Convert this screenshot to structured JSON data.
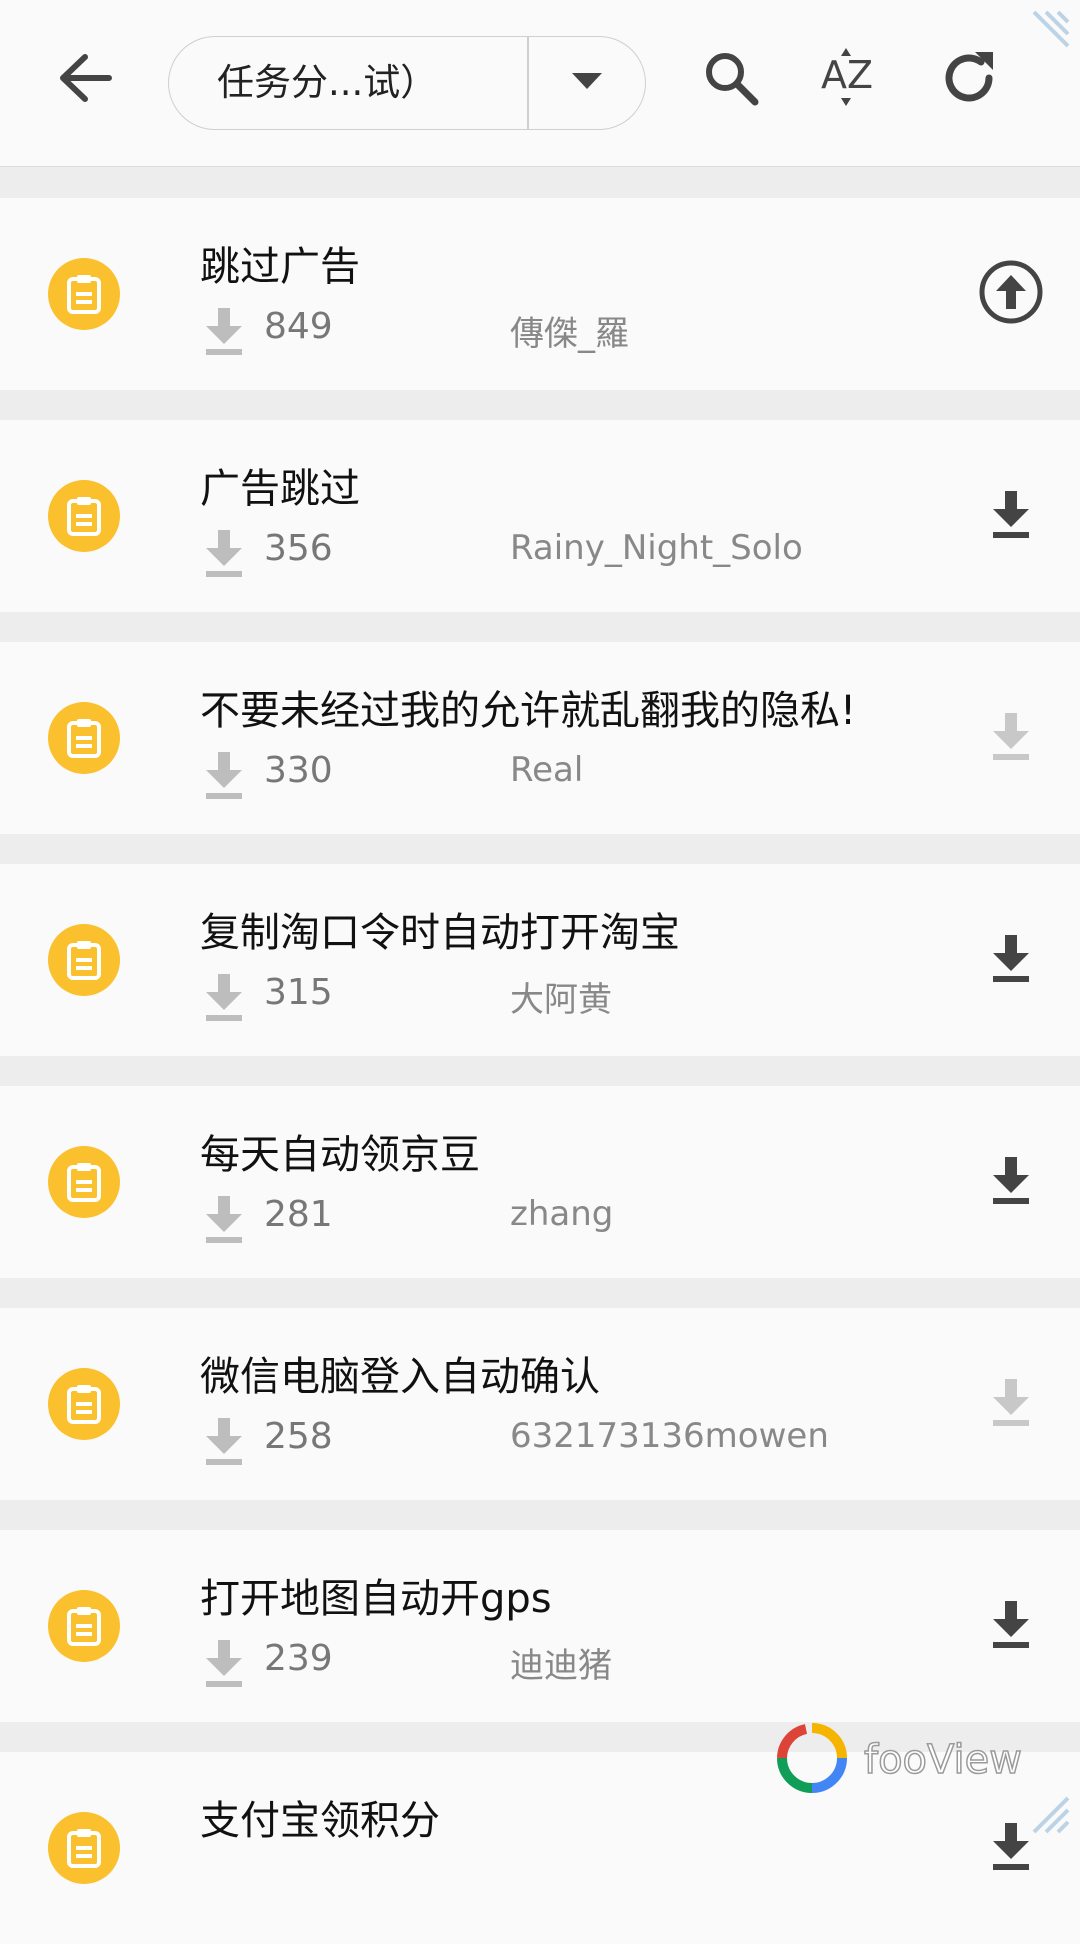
{
  "toolbar": {
    "selector_label": "任务分...试）",
    "icons": {
      "back": "arrow-left-icon",
      "dropdown": "caret-down-icon",
      "search": "search-icon",
      "sort": "sort-az-icon",
      "refresh": "refresh-icon"
    }
  },
  "items": [
    {
      "title": "跳过广告",
      "count": "849",
      "author": "傳傑_羅",
      "action": "upload",
      "action_state": "dark"
    },
    {
      "title": "广告跳过",
      "count": "356",
      "author": "Rainy_Night_Solo",
      "action": "download",
      "action_state": "dark"
    },
    {
      "title": "不要未经过我的允许就乱翻我的隐私!",
      "count": "330",
      "author": "Real",
      "action": "download",
      "action_state": "light"
    },
    {
      "title": "复制淘口令时自动打开淘宝",
      "count": "315",
      "author": "大阿黄",
      "action": "download",
      "action_state": "dark"
    },
    {
      "title": "每天自动领京豆",
      "count": "281",
      "author": "zhang",
      "action": "download",
      "action_state": "dark"
    },
    {
      "title": "微信电脑登入自动确认",
      "count": "258",
      "author": "632173136mowen",
      "action": "download",
      "action_state": "light"
    },
    {
      "title": "打开地图自动开gps",
      "count": "239",
      "author": "迪迪猪",
      "action": "download",
      "action_state": "dark"
    },
    {
      "title": "支付宝领积分",
      "count": "",
      "author": "",
      "action": "download",
      "action_state": "dark"
    }
  ],
  "watermark": {
    "text": "fooView"
  },
  "colors": {
    "item_icon": "#fbc02d",
    "action_dark": "#444444",
    "action_light": "#c8c8c8",
    "separator": "#ededed"
  }
}
